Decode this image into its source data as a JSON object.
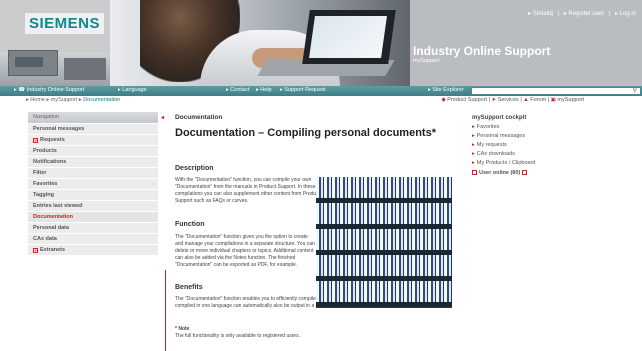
{
  "header": {
    "logo": "SIEMENS",
    "top_links": [
      "▸ Simatiq",
      "|",
      "▸ Register user",
      "|",
      "▸ Log in"
    ],
    "brand_title": "Industry Online Support",
    "brand_subtitle": "mySupport"
  },
  "navbar": {
    "items": [
      "▸ ☎ Industry Online Support",
      "▸ Language",
      "▸ Contact",
      "▸ Help",
      "▸ Support Request",
      "▸ Site Explorer"
    ],
    "search_placeholder": "",
    "search_icon": "magnifier-icon"
  },
  "breadcrumb": {
    "items": [
      "▸ Home",
      "▸ mySupport",
      "▸ Documentation"
    ]
  },
  "quick_links": {
    "items": [
      "Product Support",
      "|",
      "Services",
      "|",
      "Forum",
      "|",
      "mySupport"
    ]
  },
  "sidebar": {
    "title": "Navigation",
    "marker": "◂",
    "items": [
      {
        "label": "Personal messages",
        "box": false,
        "active": false
      },
      {
        "label": "Requests",
        "box": true,
        "active": false
      },
      {
        "label": "Products",
        "box": false,
        "active": false
      },
      {
        "label": "Notifications",
        "box": false,
        "active": false
      },
      {
        "label": "Filter",
        "box": false,
        "active": false
      },
      {
        "label": "Favorites",
        "box": false,
        "active": false
      },
      {
        "label": "Tagging",
        "box": false,
        "active": false
      },
      {
        "label": "Entries last viewed",
        "box": false,
        "active": false
      },
      {
        "label": "Documentation",
        "box": false,
        "active": true
      },
      {
        "label": "Personal data",
        "box": false,
        "active": false
      },
      {
        "label": "CAx data",
        "box": false,
        "active": false
      },
      {
        "label": "Extranets",
        "box": true,
        "active": false
      }
    ]
  },
  "main": {
    "small_title": "Documentation",
    "heading": "Documentation – Compiling personal documents*",
    "description_heading": "Description",
    "description_text": "With the \"Documentation\" function, you can compile your own \"Documentation\" from the manuals in Product Support. In these compilations you can also supplement other content from Product Support such as FAQs or curves.",
    "function_heading": "Function",
    "function_text": "The \"Documentation\" function gives you the option to create and manage your compilations in a separate structure. You can delete or move individual chapters or topics. Additional content can also be added via the Notes function. The finished \"Documentation\" can be exported as PDF, for example.",
    "benefits_heading": "Benefits",
    "benefits_text": "The \"Documentation\" function enables you to efficiently compile your own system documentation. The \"Documentation\" compiled in one language can automatically also be output in a different available language.",
    "note_label": "* Note",
    "note_text": "The full functionality is only available to registered users."
  },
  "cockpit": {
    "title": "mySupport cockpit",
    "items": [
      "Favorites",
      "Personal messages",
      "My requests",
      "CAx downloads",
      "My Products / Clipboard"
    ],
    "user_online": "User online (80)"
  }
}
